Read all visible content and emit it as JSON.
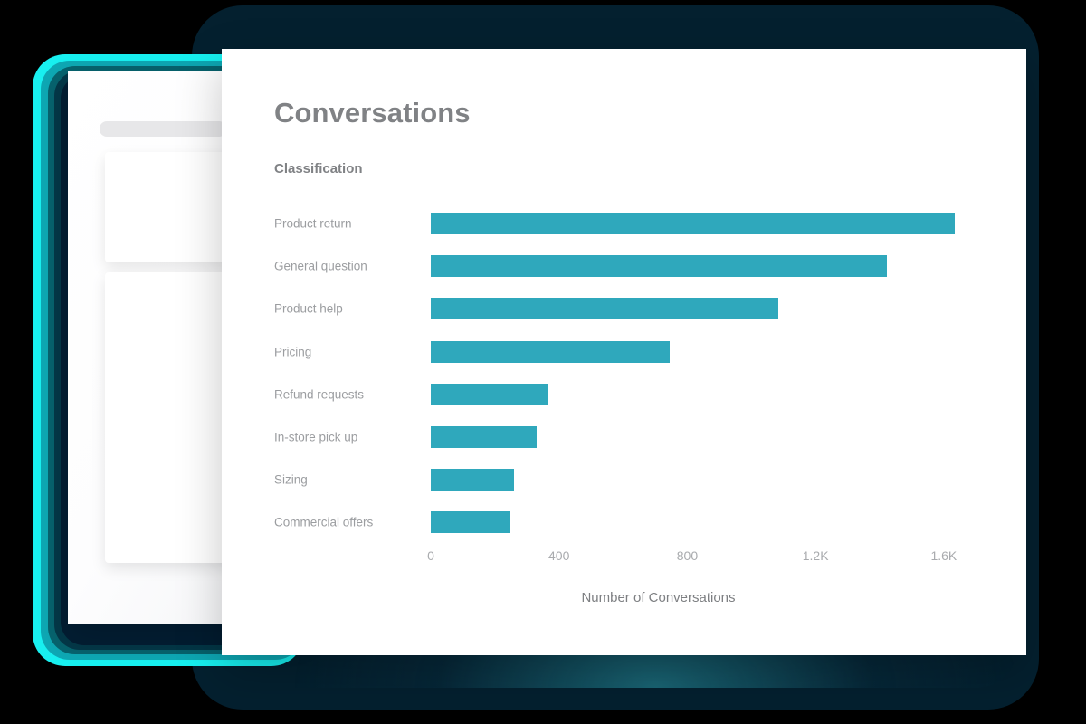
{
  "panel": {
    "title": "Conversations",
    "subtitle": "Classification"
  },
  "colors": {
    "bar": "#2fa8bc",
    "title_text": "#808285",
    "label_text": "#9b9da0",
    "tick_text": "#a9abae",
    "axis_title_text": "#7d7f82",
    "frame_navy": "#04202f",
    "glow_cyan": "#18f0f0",
    "panel_background": "#ffffff",
    "scene_background": "#000000"
  },
  "chart_data": {
    "type": "bar",
    "orientation": "horizontal",
    "title": "Conversations",
    "subtitle": "Classification",
    "xlabel": "Number of Conversations",
    "ylabel": "Classification",
    "categories": [
      "Product return",
      "General question",
      "Product help",
      "Pricing",
      "Refund requests",
      "In-store pick up",
      "Sizing",
      "Commercial offers"
    ],
    "values": [
      1634,
      1423,
      1085,
      744,
      366,
      330,
      259,
      248
    ],
    "xlim": [
      0,
      1750
    ],
    "xticks": [
      0,
      400,
      800,
      1200,
      1600
    ],
    "xticklabels": [
      "0",
      "400",
      "800",
      "1.2K",
      "1.6K"
    ],
    "grid": false,
    "legend": false,
    "series": [
      {
        "name": "Number of Conversations",
        "color": "#2fa8bc",
        "values": [
          1634,
          1423,
          1085,
          744,
          366,
          330,
          259,
          248
        ]
      }
    ]
  }
}
